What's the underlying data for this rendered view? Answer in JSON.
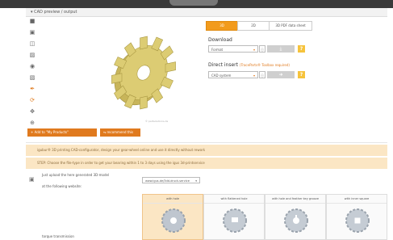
{
  "panel": {
    "title": "▾ CAD preview / output"
  },
  "tabs": [
    {
      "label": "3D",
      "active": true
    },
    {
      "label": "2D",
      "active": false
    },
    {
      "label": "3D PDF data sheet",
      "active": false
    }
  ],
  "download": {
    "title": "Download",
    "format_value": "Format",
    "button_icon": "download-icon"
  },
  "direct_insert": {
    "title": "Direct insert",
    "note": "(TraceParts® Toolbox required)",
    "cad_value": "CAD system",
    "button_icon": "arrow-right-icon"
  },
  "help_label": "?",
  "gear_copyright": "© partsolutions.de",
  "actions": {
    "add_label": "+  Add to \"My Products\"",
    "recommend_label": "recommend this Product"
  },
  "info": {
    "line1": "igubur® 3D printing CAD-configurator, design your gear-wheel online and use it directly without rework",
    "line2": "STEP: Choose the file-type in order to get your bearing within 1 to 3 days using the igus 3d-printservice"
  },
  "upload": {
    "line1": "Just upload the here generated 3D-model",
    "line2": "at the following website:",
    "site_value": "www.igus.de/3dd-druck-service"
  },
  "variants": [
    {
      "label": "with hole",
      "selected": true
    },
    {
      "label": "with flattened hole",
      "selected": false
    },
    {
      "label": "with hole and feather key groove",
      "selected": false
    },
    {
      "label": "with inner square",
      "selected": false
    }
  ],
  "bottom_label": "torque transmission",
  "colors": {
    "accent": "#e07a1e",
    "gear": "#d7c66a",
    "highlight": "#fbe6c4"
  }
}
